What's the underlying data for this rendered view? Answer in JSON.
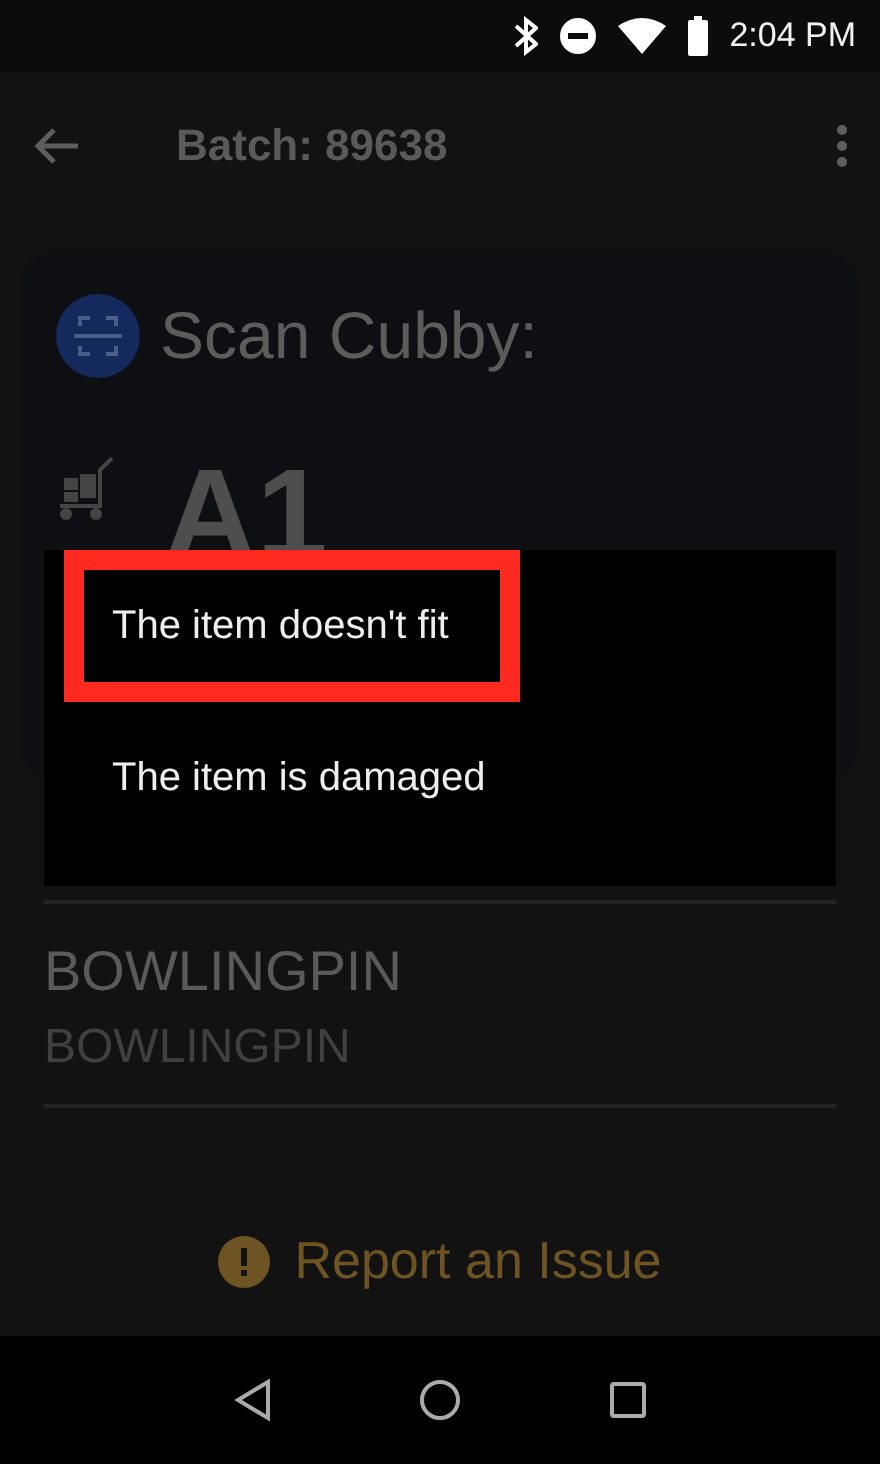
{
  "status_bar": {
    "time": "2:04 PM"
  },
  "app_bar": {
    "title": "Batch: 89638"
  },
  "card": {
    "title": "Scan Cubby:",
    "cubby": "A1"
  },
  "items": [
    {
      "name": "BOWLINGPIN",
      "subtitle": "BOWLINGPIN"
    }
  ],
  "report_button": {
    "label": "Report an Issue"
  },
  "menu": {
    "items": [
      {
        "label": "The item doesn't fit",
        "highlighted": true
      },
      {
        "label": "The item is damaged",
        "highlighted": false
      }
    ]
  }
}
